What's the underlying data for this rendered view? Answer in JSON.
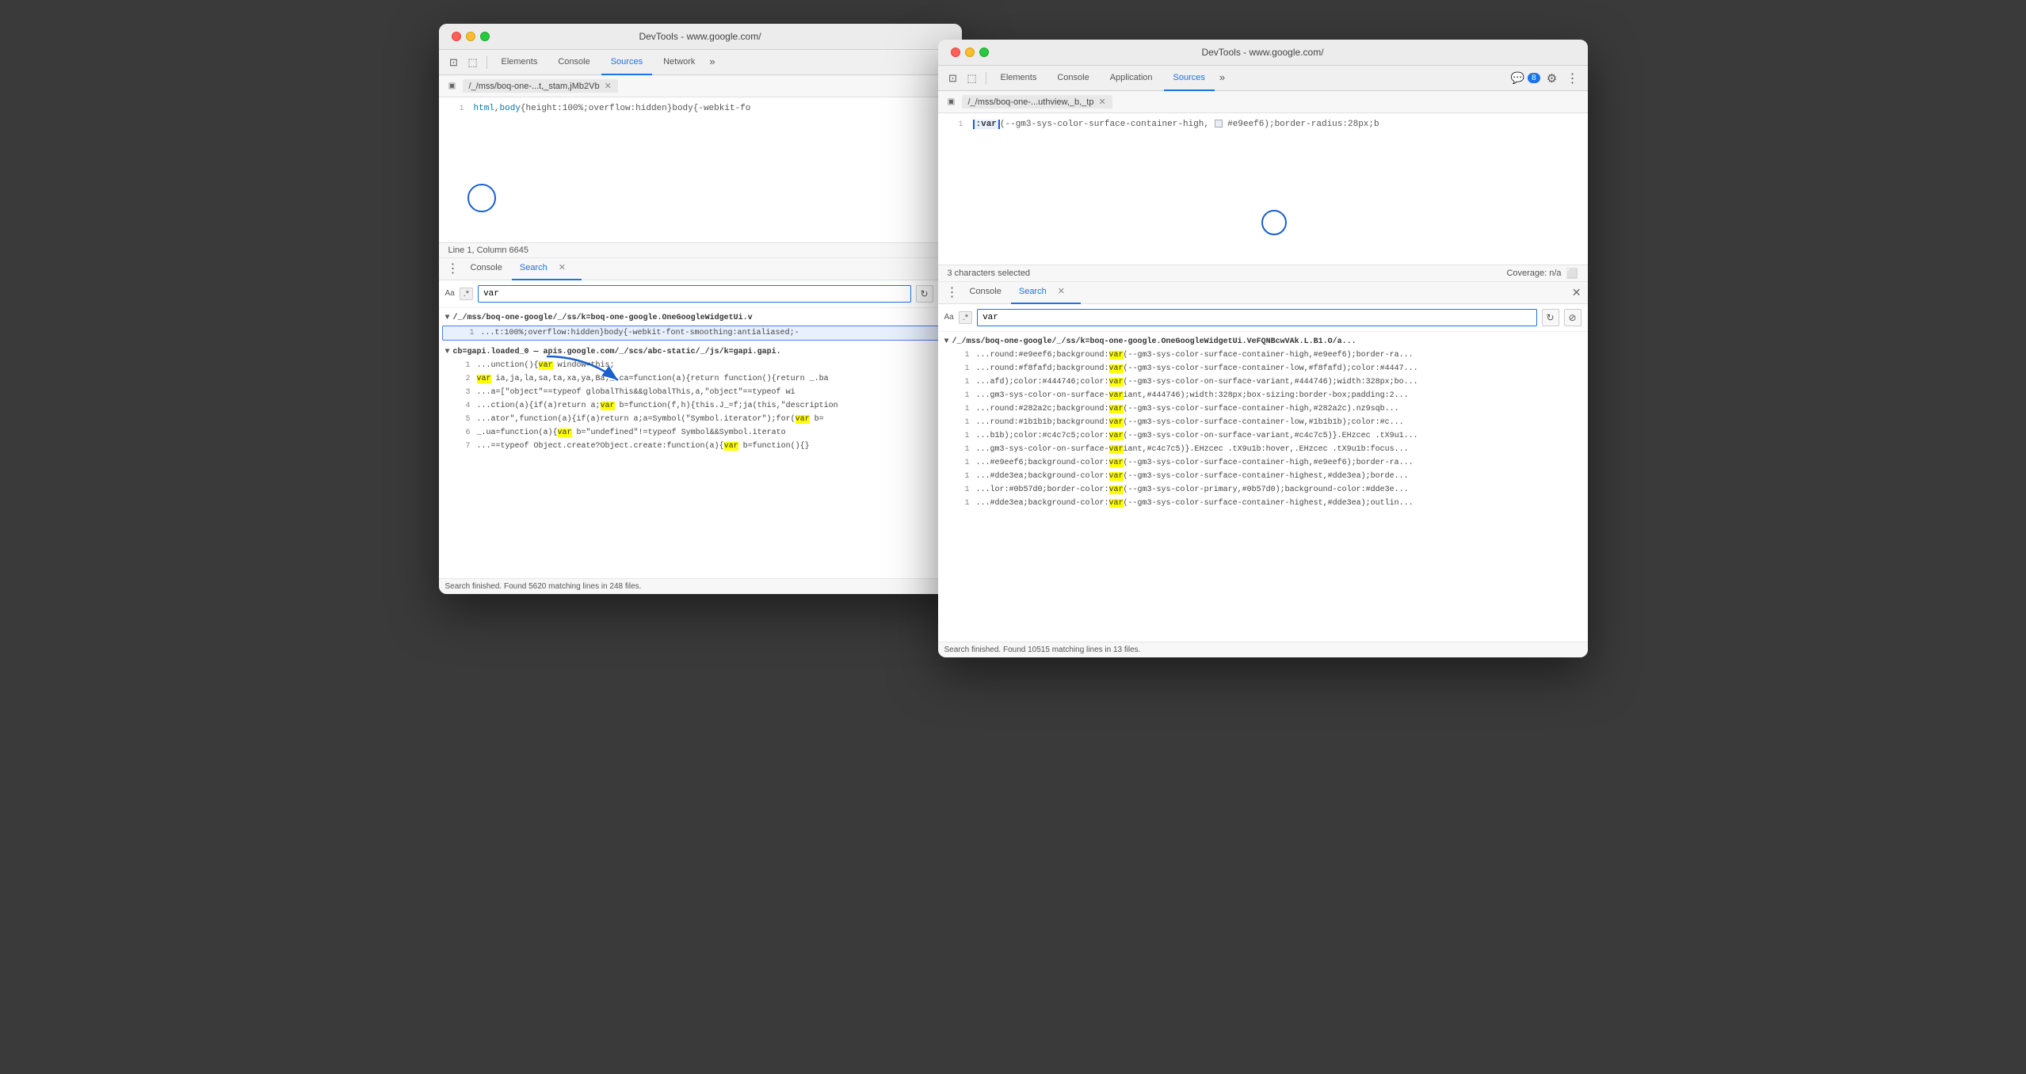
{
  "windows": {
    "left": {
      "title": "DevTools - www.google.com/",
      "tabs": [
        "Elements",
        "Console",
        "Sources",
        "Network",
        "»"
      ],
      "active_tab": "Sources",
      "file_tab": "/_/mss/boq-one-...t,_stam,jMb2Vb",
      "code_line1": "html,body{height:100%;overflow:hidden}body{-webkit-fo",
      "line_col": "Line 1, Column 6645",
      "panel_tabs": [
        "Console",
        "Search"
      ],
      "active_panel": "Search",
      "search_value": "var",
      "search_aa": "Aa",
      "search_dot": ".*",
      "result_file1": "/_/mss/boq-one-google/_/ss/k=boq-one-google.OneGoogleWidgetUi.v",
      "result_rows_file1": [
        {
          "num": "1",
          "text": "...t:100%;overflow:hidden}body{-webkit-font-smoothing:antialiased;-"
        }
      ],
      "result_file2": "cb=gapi.loaded_0  —  apis.google.com/_/scs/abc-static/_/js/k=gapi.gapi.",
      "result_rows_file2": [
        {
          "num": "1",
          "text": "...unction(){var window=this;"
        },
        {
          "num": "2",
          "text": "var ia,ja,la,sa,ta,xa,ya,Ba;_.ca=function(a){return function(){return _.ba"
        },
        {
          "num": "3",
          "text": "...a=[\"object\"==typeof globalThis&&globalThis,a,\"object\"==typeof wi"
        },
        {
          "num": "4",
          "text": "...ction(a){if(a)return a;var b=function(f,h){this.J_=f;ja(this,\"description"
        },
        {
          "num": "5",
          "text": "...ator\",function(a){if(a)return a;a=Symbol(\"Symbol.iterator\");for(var b="
        },
        {
          "num": "6",
          "text": "_.ua=function(a){var b=\"undefined\"!=typeof Symbol&&Symbol.iterato"
        },
        {
          "num": "7",
          "text": "...==typeof Object.create?Object.create:function(a){var b=function(){}"
        }
      ],
      "search_footer": "Search finished.  Found 5620 matching lines in 248 files."
    },
    "right": {
      "title": "DevTools - www.google.com/",
      "tabs": [
        "Elements",
        "Console",
        "Application",
        "Sources",
        "»"
      ],
      "active_tab": "Sources",
      "file_tab": "/_/mss/boq-one-...uthview,_b,_tp",
      "badge": "8",
      "code_line1": ":var(--gm3-sys-color-surface-container-high, □ #e9eef6);border-radius:28px;b",
      "char_selected": "3 characters selected",
      "coverage": "Coverage: n/a",
      "panel_tabs": [
        "Console",
        "Search"
      ],
      "active_panel": "Search",
      "search_value": "var",
      "search_aa": "Aa",
      "search_dot": ".*",
      "result_file1": "/_/mss/boq-one-google/_/ss/k=boq-one-google.OneGoogleWidgetUi.VeFQNBcwVAk.L.B1.O/a...",
      "result_rows": [
        {
          "num": "1",
          "text": "...round:#e9eef6;background:var(--gm3-sys-color-surface-container-high,#e9eef6);border-ra..."
        },
        {
          "num": "1",
          "text": "...round:#f8fafd;background:var(--gm3-sys-color-surface-container-low,#f8fafd);color:#4447..."
        },
        {
          "num": "1",
          "text": "...afd);color:#444746;color:var(--gm3-sys-color-on-surface-variant,#444746);width:328px;bo..."
        },
        {
          "num": "1",
          "text": "...gm3-sys-color-on-surface-variant,#444746);width:328px;box-sizing:border-box;padding:2..."
        },
        {
          "num": "1",
          "text": "...round:#282a2c;background:var(--gm3-sys-color-surface-container-high,#282a2c).nz9sqb..."
        },
        {
          "num": "1",
          "text": "...round:#1b1b1b;background:var(--gm3-sys-color-surface-container-low,#1b1b1b);color:#c..."
        },
        {
          "num": "1",
          "text": "...b1b);color:#c4c7c5;color:var(--gm3-sys-color-on-surface-variant,#c4c7c5)}.EHzcec .tX9u1..."
        },
        {
          "num": "1",
          "text": "...gm3-sys-color-on-surface-variant,#c4c7c5)}.EHzcec .tX9u1b:hover,.EHzcec .tX9u1b:focus..."
        },
        {
          "num": "1",
          "text": "...#e9eef6;background-color:var(--gm3-sys-color-surface-container-high,#e9eef6);border-ra..."
        },
        {
          "num": "1",
          "text": "...#dde3ea;background-color:var(--gm3-sys-color-surface-container-highest,#dde3ea);borde..."
        },
        {
          "num": "1",
          "text": "...lor:#0b57d0;border-color:var(--gm3-sys-color-primary,#0b57d0);background-color:#dde3e..."
        },
        {
          "num": "1",
          "text": "...#dde3ea;background-color:var(--gm3-sys-color-surface-container-highest,#dde3ea);outlin..."
        }
      ],
      "search_footer": "Search finished.  Found 10515 matching lines in 13 files."
    }
  }
}
